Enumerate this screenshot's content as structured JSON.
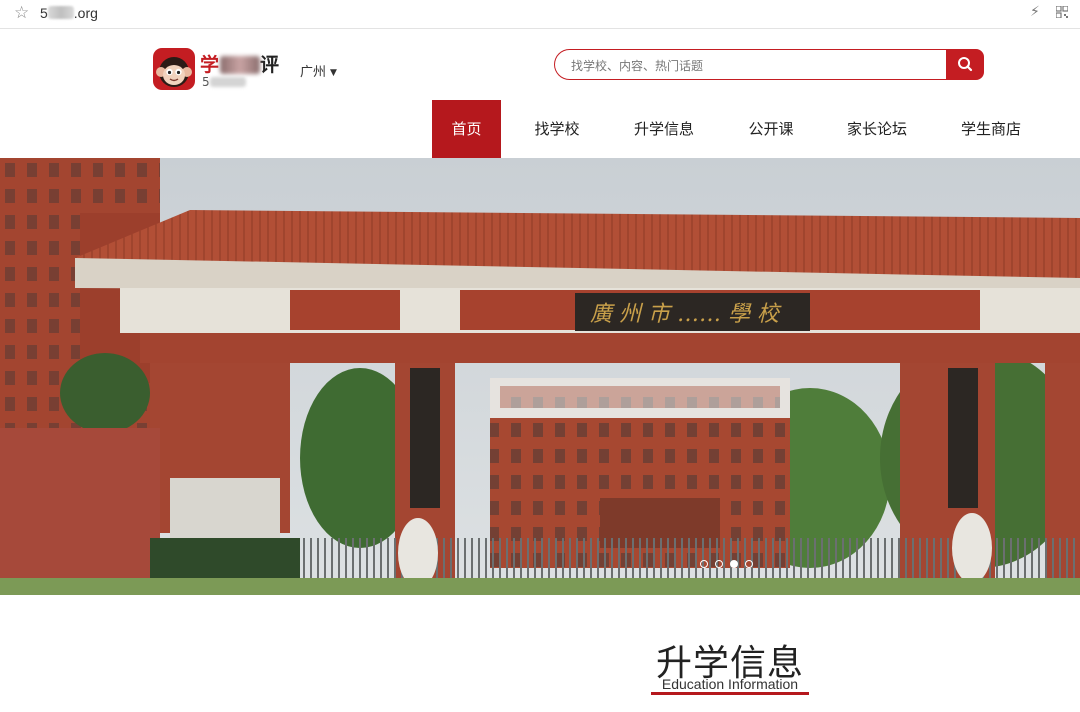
{
  "browser": {
    "url_prefix": "5",
    "url_suffix": ".org",
    "star_icon": "star-icon",
    "bolt_icon": "lightning-icon",
    "qr_icon": "qr-code-icon"
  },
  "header": {
    "brand_first": "学",
    "brand_last": "评",
    "sub_prefix": "5",
    "city": "广州",
    "search_placeholder": "找学校、内容、热门话题"
  },
  "nav": {
    "items": [
      {
        "label": "首页",
        "active": true
      },
      {
        "label": "找学校",
        "active": false
      },
      {
        "label": "升学信息",
        "active": false
      },
      {
        "label": "公开课",
        "active": false
      },
      {
        "label": "家长论坛",
        "active": false
      },
      {
        "label": "学生商店",
        "active": false
      }
    ]
  },
  "banner": {
    "slide_count": 4,
    "active_slide": 3
  },
  "section": {
    "title": "升学信息",
    "subtitle": "Education Information"
  },
  "colors": {
    "brand_red": "#c41d22",
    "nav_active": "#b5181d"
  }
}
